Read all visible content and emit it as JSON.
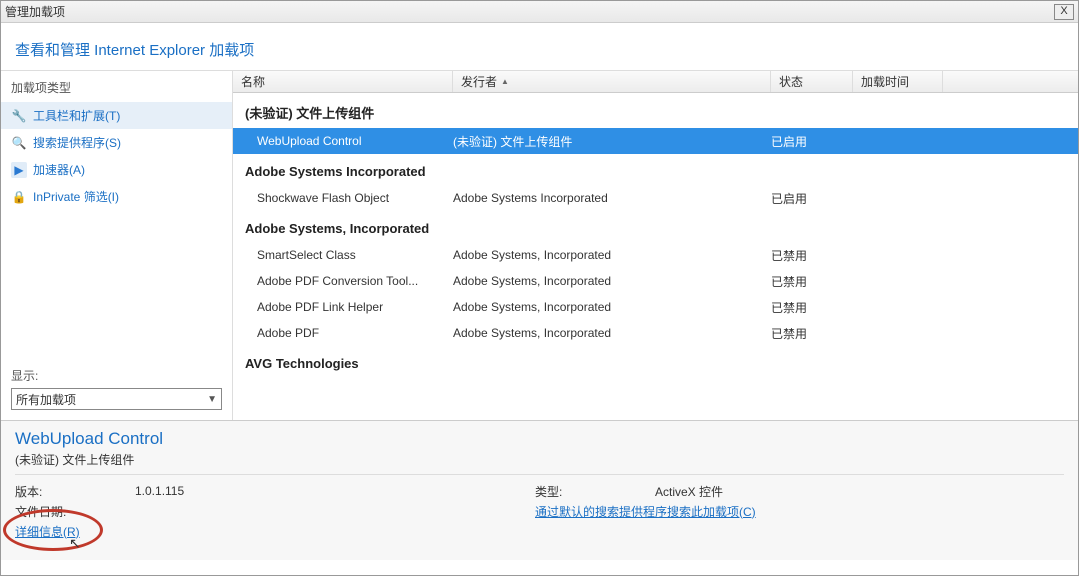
{
  "window": {
    "title": "管理加载项",
    "close": "X"
  },
  "header": {
    "heading": "查看和管理 Internet Explorer 加载项"
  },
  "sidebar": {
    "type_label": "加载项类型",
    "items": [
      {
        "label": "工具栏和扩展(T)",
        "icon": "🔧",
        "selected": true
      },
      {
        "label": "搜索提供程序(S)",
        "icon": "🔍",
        "selected": false
      },
      {
        "label": "加速器(A)",
        "icon": "▶",
        "selected": false
      },
      {
        "label": "InPrivate 筛选(I)",
        "icon": "🔒",
        "selected": false
      }
    ],
    "show_label": "显示:",
    "dropdown_value": "所有加载项"
  },
  "columns": {
    "name": "名称",
    "publisher": "发行者",
    "status": "状态",
    "load_time": "加载时间"
  },
  "groups": [
    {
      "header": "(未验证) 文件上传组件",
      "rows": [
        {
          "name": "WebUpload Control",
          "publisher": "(未验证) 文件上传组件",
          "status": "已启用",
          "selected": true
        }
      ]
    },
    {
      "header": "Adobe Systems Incorporated",
      "rows": [
        {
          "name": "Shockwave Flash Object",
          "publisher": "Adobe Systems Incorporated",
          "status": "已启用",
          "selected": false
        }
      ]
    },
    {
      "header": "Adobe Systems, Incorporated",
      "rows": [
        {
          "name": "SmartSelect Class",
          "publisher": "Adobe Systems, Incorporated",
          "status": "已禁用",
          "selected": false
        },
        {
          "name": "Adobe PDF Conversion Tool...",
          "publisher": "Adobe Systems, Incorporated",
          "status": "已禁用",
          "selected": false
        },
        {
          "name": "Adobe PDF Link Helper",
          "publisher": "Adobe Systems, Incorporated",
          "status": "已禁用",
          "selected": false
        },
        {
          "name": "Adobe PDF",
          "publisher": "Adobe Systems, Incorporated",
          "status": "已禁用",
          "selected": false
        }
      ]
    },
    {
      "header": "AVG Technologies",
      "rows": []
    }
  ],
  "details": {
    "title": "WebUpload Control",
    "subtitle": "(未验证) 文件上传组件",
    "version_label": "版本:",
    "version_value": "1.0.1.115",
    "file_date_label": "文件日期:",
    "more_info": "详细信息(R)",
    "type_label": "类型:",
    "type_value": "ActiveX 控件",
    "search_link": "通过默认的搜索提供程序搜索此加载项(C)"
  }
}
